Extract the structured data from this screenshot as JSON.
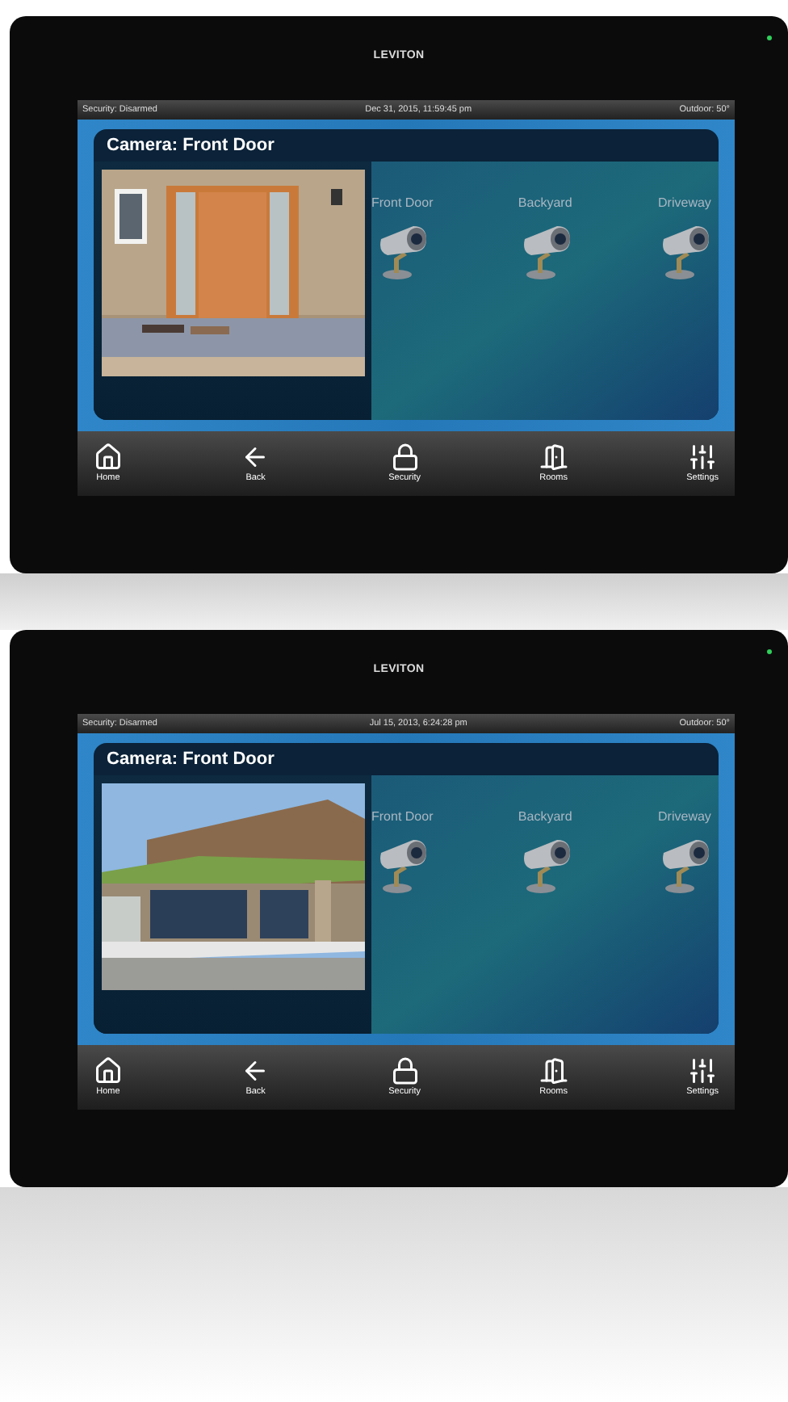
{
  "devices": [
    {
      "brand": "LEVITON",
      "status_bar": {
        "security": "Security: Disarmed",
        "datetime": "Dec 31, 2015, 11:59:45 pm",
        "outdoor": "Outdoor: 50°"
      },
      "title": "Camera: Front Door",
      "cameras": [
        {
          "label": "Front Door"
        },
        {
          "label": "Backyard"
        },
        {
          "label": "Driveway"
        }
      ],
      "nav": [
        {
          "label": "Home",
          "kind": "home"
        },
        {
          "label": "Back",
          "kind": "back"
        },
        {
          "label": "Security",
          "kind": "security"
        },
        {
          "label": "Rooms",
          "kind": "rooms"
        },
        {
          "label": "Settings",
          "kind": "settings"
        }
      ]
    },
    {
      "brand": "LEVITON",
      "status_bar": {
        "security": "Security: Disarmed",
        "datetime": "Jul 15, 2013, 6:24:28 pm",
        "outdoor": "Outdoor: 50°"
      },
      "title": "Camera: Front Door",
      "cameras": [
        {
          "label": "Front Door"
        },
        {
          "label": "Backyard"
        },
        {
          "label": "Driveway"
        }
      ],
      "nav": [
        {
          "label": "Home",
          "kind": "home"
        },
        {
          "label": "Back",
          "kind": "back"
        },
        {
          "label": "Security",
          "kind": "security"
        },
        {
          "label": "Rooms",
          "kind": "rooms"
        },
        {
          "label": "Settings",
          "kind": "settings"
        }
      ]
    }
  ]
}
